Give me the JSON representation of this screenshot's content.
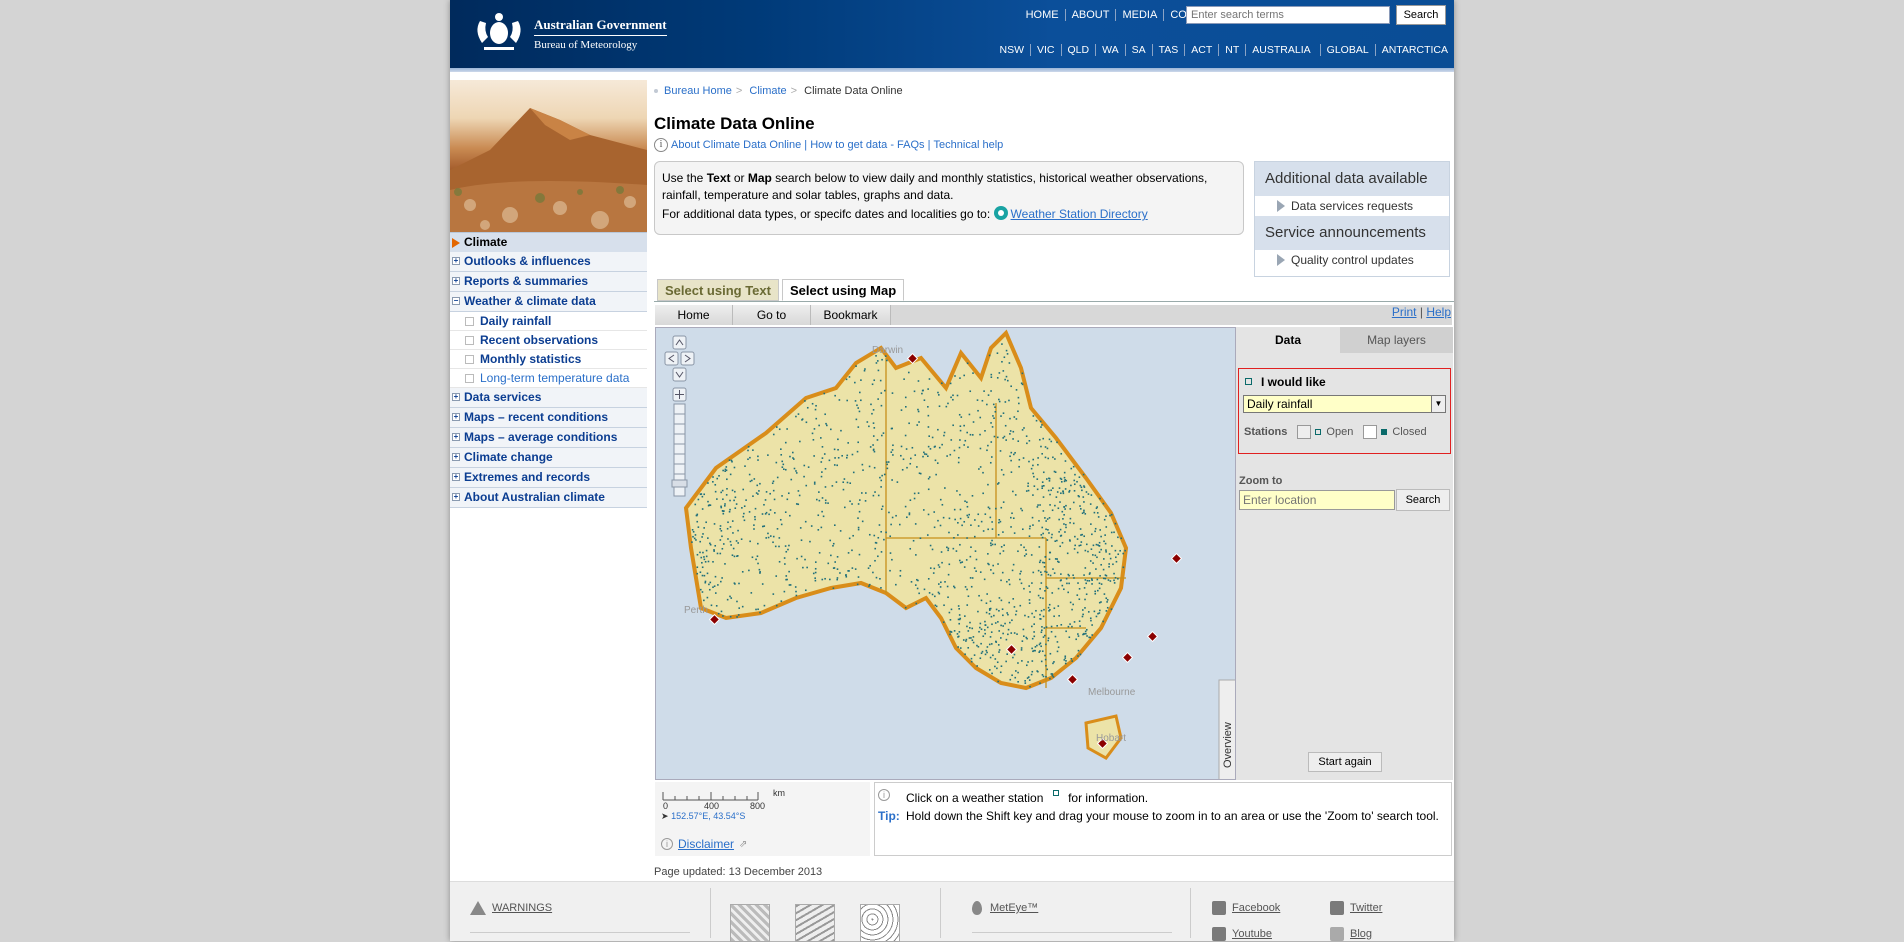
{
  "header": {
    "logo_line1": "Australian Government",
    "logo_line2": "Bureau of Meteorology",
    "top_nav": [
      "HOME",
      "ABOUT",
      "MEDIA",
      "CONTACTS"
    ],
    "search_placeholder": "Enter search terms",
    "search_button": "Search",
    "state_nav": [
      "NSW",
      "VIC",
      "QLD",
      "WA",
      "SA",
      "TAS",
      "ACT",
      "NT",
      "AUSTRALIA",
      "GLOBAL",
      "ANTARCTICA"
    ]
  },
  "sidebar": {
    "heading": "Climate",
    "items": [
      {
        "label": "Outlooks & influences",
        "expanded": false
      },
      {
        "label": "Reports & summaries",
        "expanded": false
      },
      {
        "label": "Weather & climate data",
        "expanded": true
      }
    ],
    "subitems": [
      "Daily rainfall",
      "Recent observations",
      "Monthly statistics",
      "Long-term temperature data"
    ],
    "items_after": [
      "Data services",
      "Maps – recent conditions",
      "Maps – average conditions",
      "Climate change",
      "Extremes and records",
      "About Australian climate"
    ]
  },
  "breadcrumb": [
    "Bureau Home",
    "Climate",
    "Climate Data Online"
  ],
  "page_title": "Climate Data Online",
  "info_links": [
    "About Climate Data Online",
    "How to get data - FAQs",
    "Technical help"
  ],
  "intro": {
    "p1_a": "Use the ",
    "p1_text": "Text",
    "p1_b": " or ",
    "p1_map": "Map",
    "p1_c": " search below to view daily and monthly statistics, historical weather observations, rainfall, temperature and solar tables, graphs and data.",
    "p2": "For additional data types, or specifc dates and localities go to:",
    "link": "Weather Station Directory"
  },
  "additional": {
    "heading1": "Additional data available",
    "item1": "Data services requests",
    "heading2": "Service announcements",
    "item2": "Quality control updates"
  },
  "tabs": [
    "Select using Text",
    "Select using Map"
  ],
  "map_toolbar": [
    "Home",
    "Go to",
    "Bookmark"
  ],
  "print": "Print",
  "help": "Help",
  "map_labels": [
    "Darwin",
    "Perth",
    "Melbourne",
    "Hobart"
  ],
  "overview": "Overview",
  "panel": {
    "tab_data": "Data",
    "tab_layers": "Map layers",
    "would_like": "I would like",
    "selected": "Daily rainfall",
    "stations": "Stations",
    "open": "Open",
    "closed": "Closed",
    "zoom_to": "Zoom to",
    "zoom_placeholder": "Enter location",
    "zoom_button": "Search",
    "start_again": "Start again"
  },
  "scale": {
    "ticks": [
      "0",
      "400",
      "800"
    ],
    "unit": "km",
    "coords": "152.57°E, 43.54°S",
    "disclaimer": "Disclaimer"
  },
  "tip": {
    "click_a": "Click on a weather station",
    "click_b": "for information.",
    "tip_label": "Tip:",
    "tip_text": "Hold down the Shift key and drag your mouse to zoom in to an area or use the 'Zoom to' search tool."
  },
  "page_updated": "Page updated: 13 December 2013",
  "footer": {
    "warnings": "WARNINGS",
    "meteye": "MetEye™",
    "facebook": "Facebook",
    "twitter": "Twitter",
    "youtube": "Youtube",
    "blog": "Blog"
  },
  "colors": {
    "header_blue": "#003a78",
    "link": "#2a6fc9",
    "land": "#ece3a8",
    "sea": "#cfdce9",
    "station": "#1f6f7a",
    "coast": "#d98d1a"
  }
}
